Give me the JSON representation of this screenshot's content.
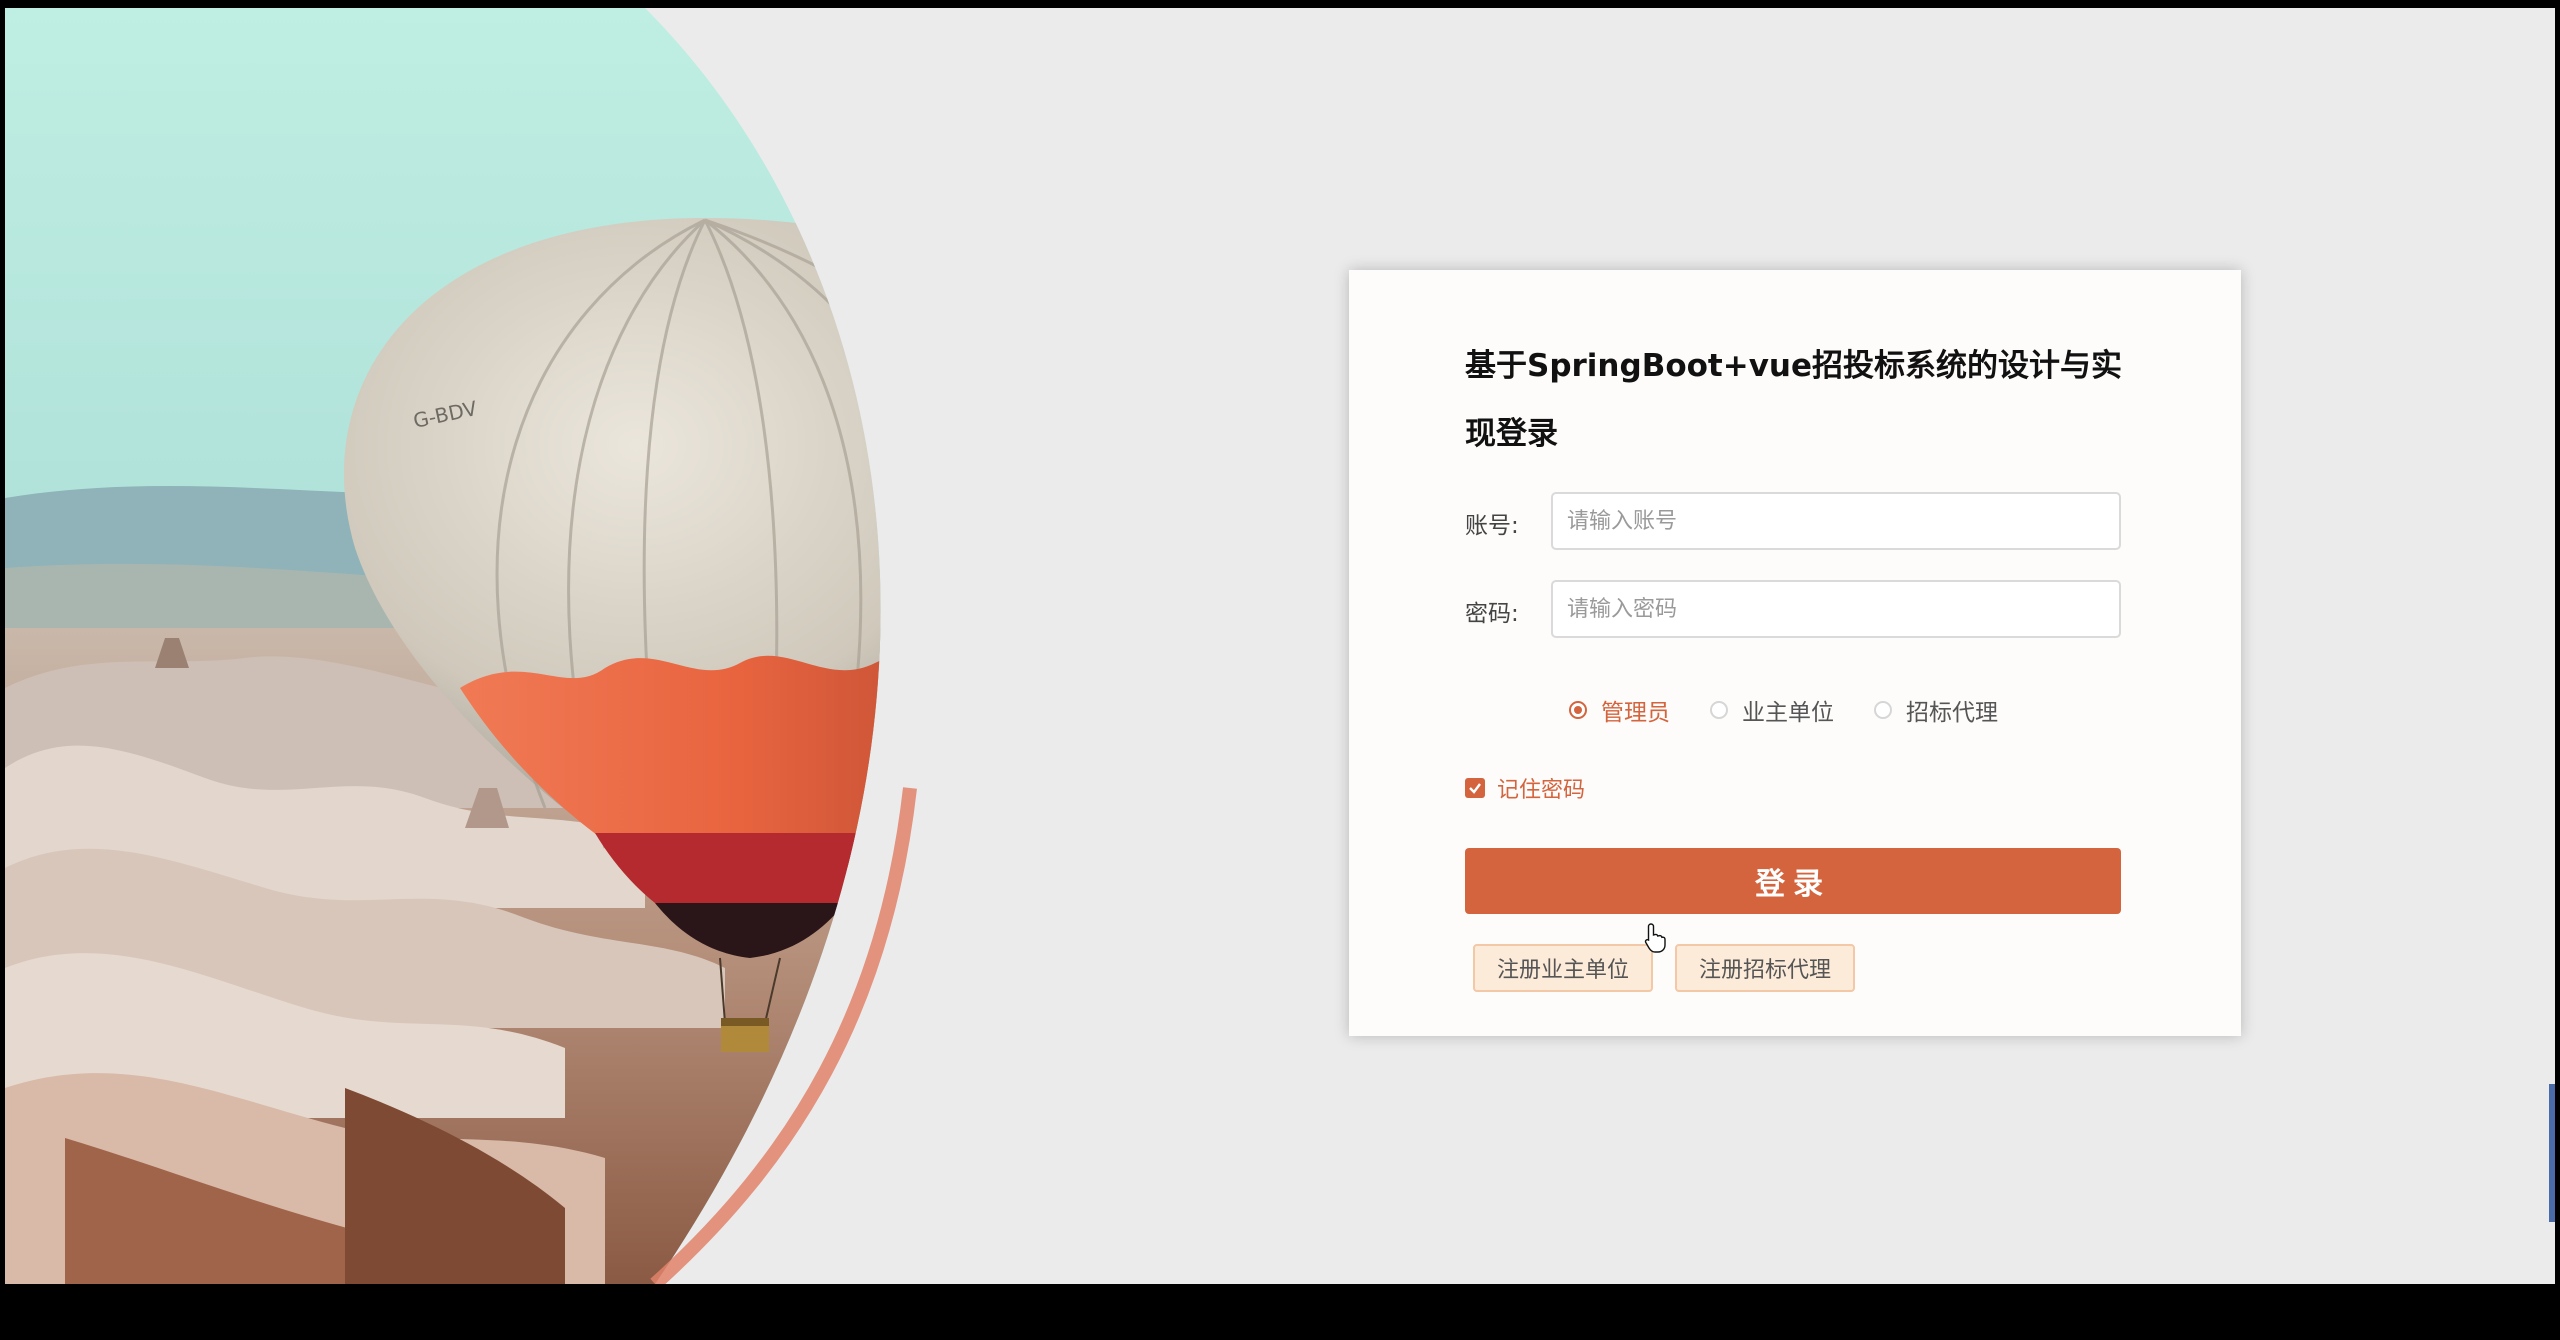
{
  "login": {
    "title": "基于SpringBoot+vue招投标系统的设计与实现登录",
    "account_label": "账号:",
    "account_placeholder": "请输入账号",
    "password_label": "密码:",
    "password_placeholder": "请输入密码",
    "roles": [
      {
        "label": "管理员",
        "checked": true
      },
      {
        "label": "业主单位",
        "checked": false
      },
      {
        "label": "招标代理",
        "checked": false
      }
    ],
    "remember_label": "记住密码",
    "remember_checked": true,
    "login_button": "登录",
    "register_owner_button": "注册业主单位",
    "register_agent_button": "注册招标代理"
  },
  "hero": {
    "balloon_registration": "G-BDV"
  },
  "colors": {
    "accent": "#d3643e",
    "page_bg": "#ebebeb",
    "card_bg": "#fdfcfa",
    "register_button_bg": "#fdebd9"
  },
  "icons": {
    "remember_check": "check-icon",
    "pointer": "hand-cursor-icon"
  }
}
